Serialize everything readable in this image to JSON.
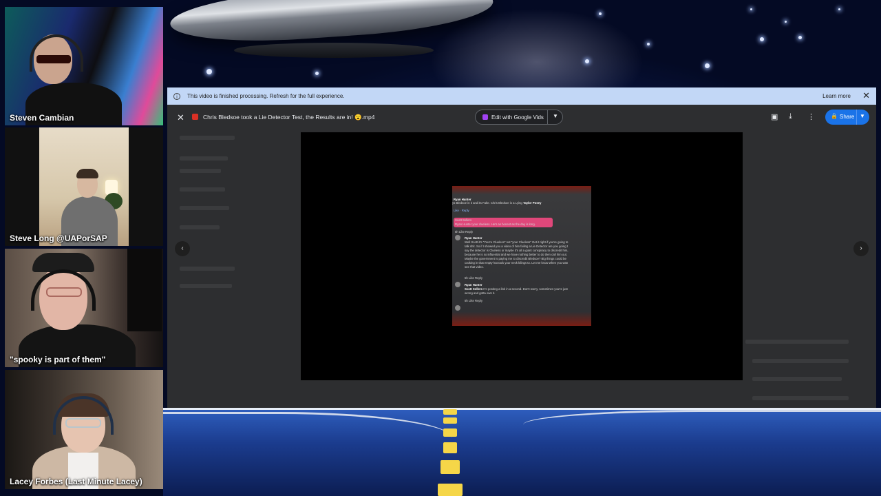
{
  "participants": [
    {
      "name": "Steven Cambian"
    },
    {
      "name": "Steve Long @UAPorSAP"
    },
    {
      "name": "\"spooky is part of them\""
    },
    {
      "name": "Lacey Forbes (Last Minute Lacey)"
    }
  ],
  "banner": {
    "message": "This video is finished processing. Refresh for the full experience.",
    "learn_more": "Learn more",
    "close_symbol": "✕"
  },
  "viewer": {
    "close_symbol": "✕",
    "file_title": "Chris Bledsoe took a Lie Detector Test, the Results are in! 😮.mp4",
    "edit_button": "Edit with Google Vids",
    "share_button": "Share",
    "prev_symbol": "‹",
    "next_symbol": "›"
  },
  "video_frame": {
    "line1_name": "Ryan Hunter",
    "line1_text": "ys Bledsoe in it and its Fake. Chris Bledsoe is a Lying",
    "line1_bold": "Taylor Posey",
    "bubble_name": "Scott Sellers",
    "bubble_text": "Ryan Hunter your clueless. He's as honest as the day is long.",
    "reply_name": "Ryan Hunter",
    "reply_lines": [
      "Well Scott it's \"You're Clueless\" not \"your Clueless\" Get it right if you're going to",
      "talk shit. So if I showed you a video of him failing a Lie Detector are you going t",
      "say the detector is Clueless or maybe it's all a giant conspiracy to discredit him,",
      "because he is so influential and we have nothing better to do then call him out.",
      "Maybe the government is paying me to discredit Bledsoe? Big things could be",
      "cooking in that empty hat rack your neck kilings to. Let me know when you wan",
      "see that video."
    ],
    "last_name": "Ryan Hunter",
    "last_bold": "Scott Sellers",
    "last_text": "I'm posting a link in a second. Don't worry, sometimes you're just",
    "last_text2": "wrong and gotta own it.",
    "actions": "5h   Like   Reply"
  },
  "colors": {
    "banner": "#c2d7f6",
    "share": "#1a73e8",
    "viewer_bg": "#2d2e30",
    "road_dash": "#f5d648"
  },
  "icons": [
    "info-icon",
    "close-icon",
    "file-video-icon",
    "vids-icon",
    "chevron-down-icon",
    "add-comment-icon",
    "download-icon",
    "more-vert-icon",
    "lock-icon",
    "chevron-left-icon",
    "chevron-right-icon"
  ]
}
